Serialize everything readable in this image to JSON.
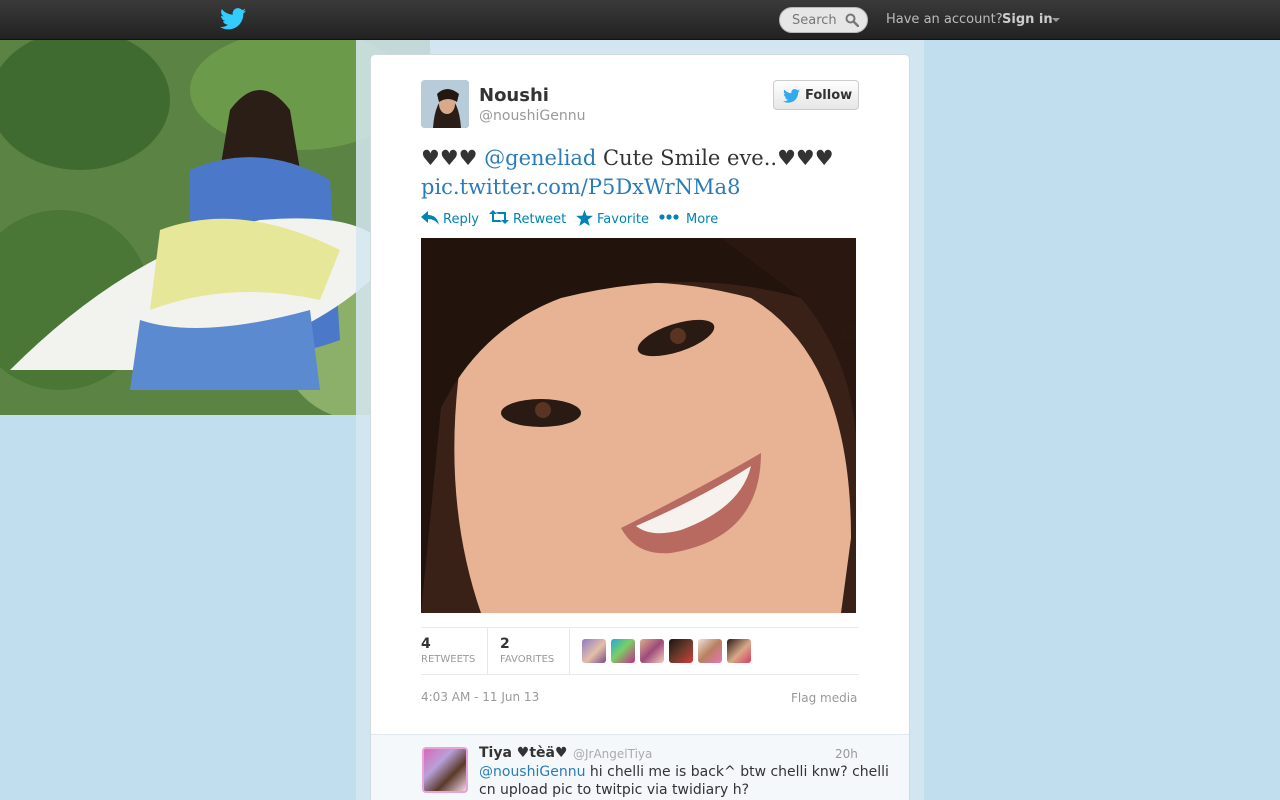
{
  "topbar": {
    "search_placeholder": "Search",
    "account_question": "Have an account?",
    "signin_label": "Sign in"
  },
  "tweet": {
    "author_name": "Noushi",
    "author_handle": "@noushiGennu",
    "follow_label": "Follow",
    "text_prefix": "♥♥♥ ",
    "mention": "@geneliad",
    "text_body": " Cute Smile eve..♥♥♥",
    "pic_link": "pic.twitter.com/P5DxWrNMa8",
    "actions": {
      "reply": "Reply",
      "retweet": "Retweet",
      "favorite": "Favorite",
      "more": "More"
    },
    "stats": {
      "retweets_count": "4",
      "retweets_label": "RETWEETS",
      "favorites_count": "2",
      "favorites_label": "FAVORITES"
    },
    "timestamp": "4:03 AM - 11 Jun 13",
    "flag_label": "Flag media"
  },
  "reply": {
    "author_name": "Tiya ♥tèä♥",
    "author_handle": "@JrAngelTiya",
    "time": "20h",
    "mention": "@noushiGennu",
    "text": " hi chelli me is back^ btw chelli knw? chelli cn upload pic to twitpic via twidiary h?"
  },
  "colors": {
    "link": "#2b7bb9",
    "action": "#0084b4",
    "background": "#c0deed",
    "topbar": "#2a2a2a"
  }
}
